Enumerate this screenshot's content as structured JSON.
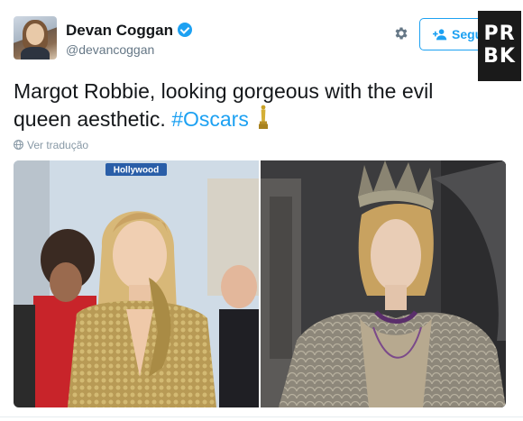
{
  "user": {
    "display_name": "Devan Coggan",
    "handle": "@devancoggan",
    "verified": true
  },
  "follow_button": {
    "label": "Segu"
  },
  "watermark": {
    "text": "PRBK"
  },
  "tweet": {
    "text": "Margot Robbie, looking gorgeous with the evil queen aesthetic. ",
    "hashtag": "#Oscars",
    "emoji": "trophy-oscar-emoji"
  },
  "translate": {
    "label": "Ver tradução"
  },
  "media": {
    "photos": [
      {
        "name": "red-carpet-photo",
        "sign_text": "Hollywood"
      },
      {
        "name": "evil-queen-photo"
      }
    ]
  },
  "colors": {
    "accent": "#1da1f2",
    "text": "#14171a",
    "muted": "#657786",
    "logo_bg": "#1a1a1a"
  },
  "icons": [
    "verified-badge-icon",
    "gear-icon",
    "follow-user-icon",
    "globe-icon",
    "oscar-statuette-icon"
  ]
}
